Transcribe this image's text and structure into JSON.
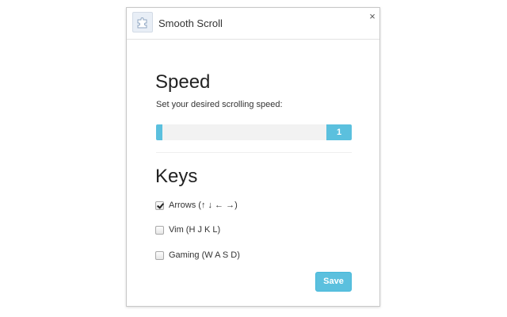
{
  "window": {
    "title": "Smooth Scroll",
    "icon": "puzzle-piece-icon",
    "close_glyph": "×"
  },
  "speed": {
    "heading": "Speed",
    "description": "Set your desired scrolling speed:",
    "slider": {
      "value": 1,
      "value_text": "1",
      "fill_fraction": 0.03
    }
  },
  "keys": {
    "heading": "Keys",
    "options": [
      {
        "label": "Arrows (↑ ↓ ← →)",
        "checked": true
      },
      {
        "label": "Vim (H J K L)",
        "checked": false
      },
      {
        "label": "Gaming (W A S D)",
        "checked": false
      }
    ]
  },
  "actions": {
    "save_label": "Save"
  },
  "colors": {
    "accent": "#5bc0de",
    "track": "#f2f2f2",
    "border": "#c8c8c8"
  }
}
